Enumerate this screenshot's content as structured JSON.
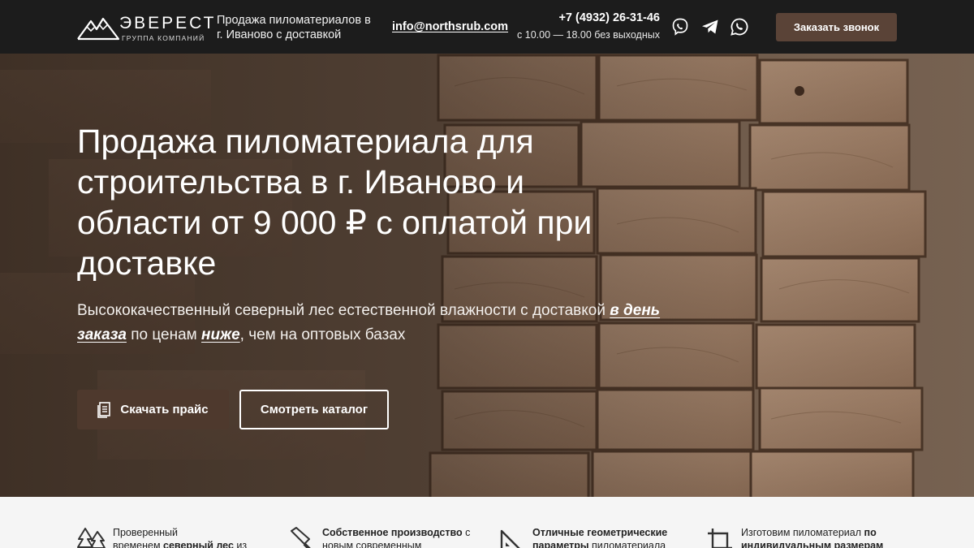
{
  "header": {
    "logo_name": "ЭВЕРЕСТ",
    "logo_sub": "ГРУППА КОМПАНИЙ",
    "tagline_line1": "Продажа пиломатериалов в",
    "tagline_line2": "г. Иваново с доставкой",
    "email": "info@northsrub.com",
    "phone": "+7 (4932) 26-31-46",
    "hours": "с 10.00 — 18.00 без выходных",
    "social": [
      "viber-icon",
      "telegram-icon",
      "whatsapp-icon"
    ],
    "callback_label": "Заказать звонок"
  },
  "hero": {
    "title": "Продажа пиломатериала для строительства в г. Иваново и области от 9 000 ₽ с оплатой при доставке",
    "subtitle_part1": "Высококачественный северный лес естественной влажности с доставкой ",
    "subtitle_hl1": "в день заказа",
    "subtitle_part2": " по ценам ",
    "subtitle_hl2": "ниже",
    "subtitle_part3": ", чем на оптовых базах",
    "btn_price": "Скачать прайс",
    "btn_catalog": "Смотреть каталог"
  },
  "features": [
    {
      "icon": "forest-icon",
      "pre": "Проверенный",
      "bold": "",
      "line2_pre": "временем ",
      "line2_bold": "северный лес",
      "line2_post": " из"
    },
    {
      "icon": "saw-icon",
      "pre": "",
      "bold": "Собственное производство",
      "post": " с",
      "line2_pre": "новым современным",
      "line2_bold": "",
      "line2_post": ""
    },
    {
      "icon": "ruler-triangle-icon",
      "pre": "",
      "bold": "Отличные геометрические",
      "post": "",
      "line2_pre": "",
      "line2_bold": "параметры",
      "line2_post": " пиломатериала"
    },
    {
      "icon": "crop-icon",
      "pre": "Изготовим пиломатериал ",
      "bold": "по",
      "post": "",
      "line2_pre": "",
      "line2_bold": "индивидуальным размерам",
      "line2_post": ""
    }
  ],
  "colors": {
    "header_bg": "#1c1c1c",
    "accent": "#5a4337",
    "button_dark": "#4e392d",
    "features_bg": "#f5f5f5"
  }
}
